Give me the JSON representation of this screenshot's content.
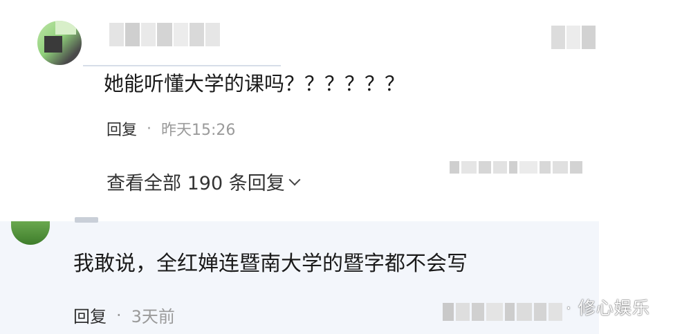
{
  "colors": {
    "text_primary": "#1a1a1a",
    "text_secondary": "#9a9a9a",
    "reply_bg": "#f3f6fb"
  },
  "comments": [
    {
      "avatar_icon": "avatar-icon",
      "text": "她能听懂大学的课吗？？？？？？",
      "reply_label": "回复",
      "separator": "·",
      "time": "昨天15:26",
      "view_replies": "查看全部 190 条回复"
    },
    {
      "avatar_icon": "avatar-icon",
      "text": "我敢说，全红婵连暨南大学的暨字都不会写",
      "reply_label": "回复",
      "separator": "·",
      "time": "3天前"
    }
  ],
  "watermark": "· 修心娱乐"
}
